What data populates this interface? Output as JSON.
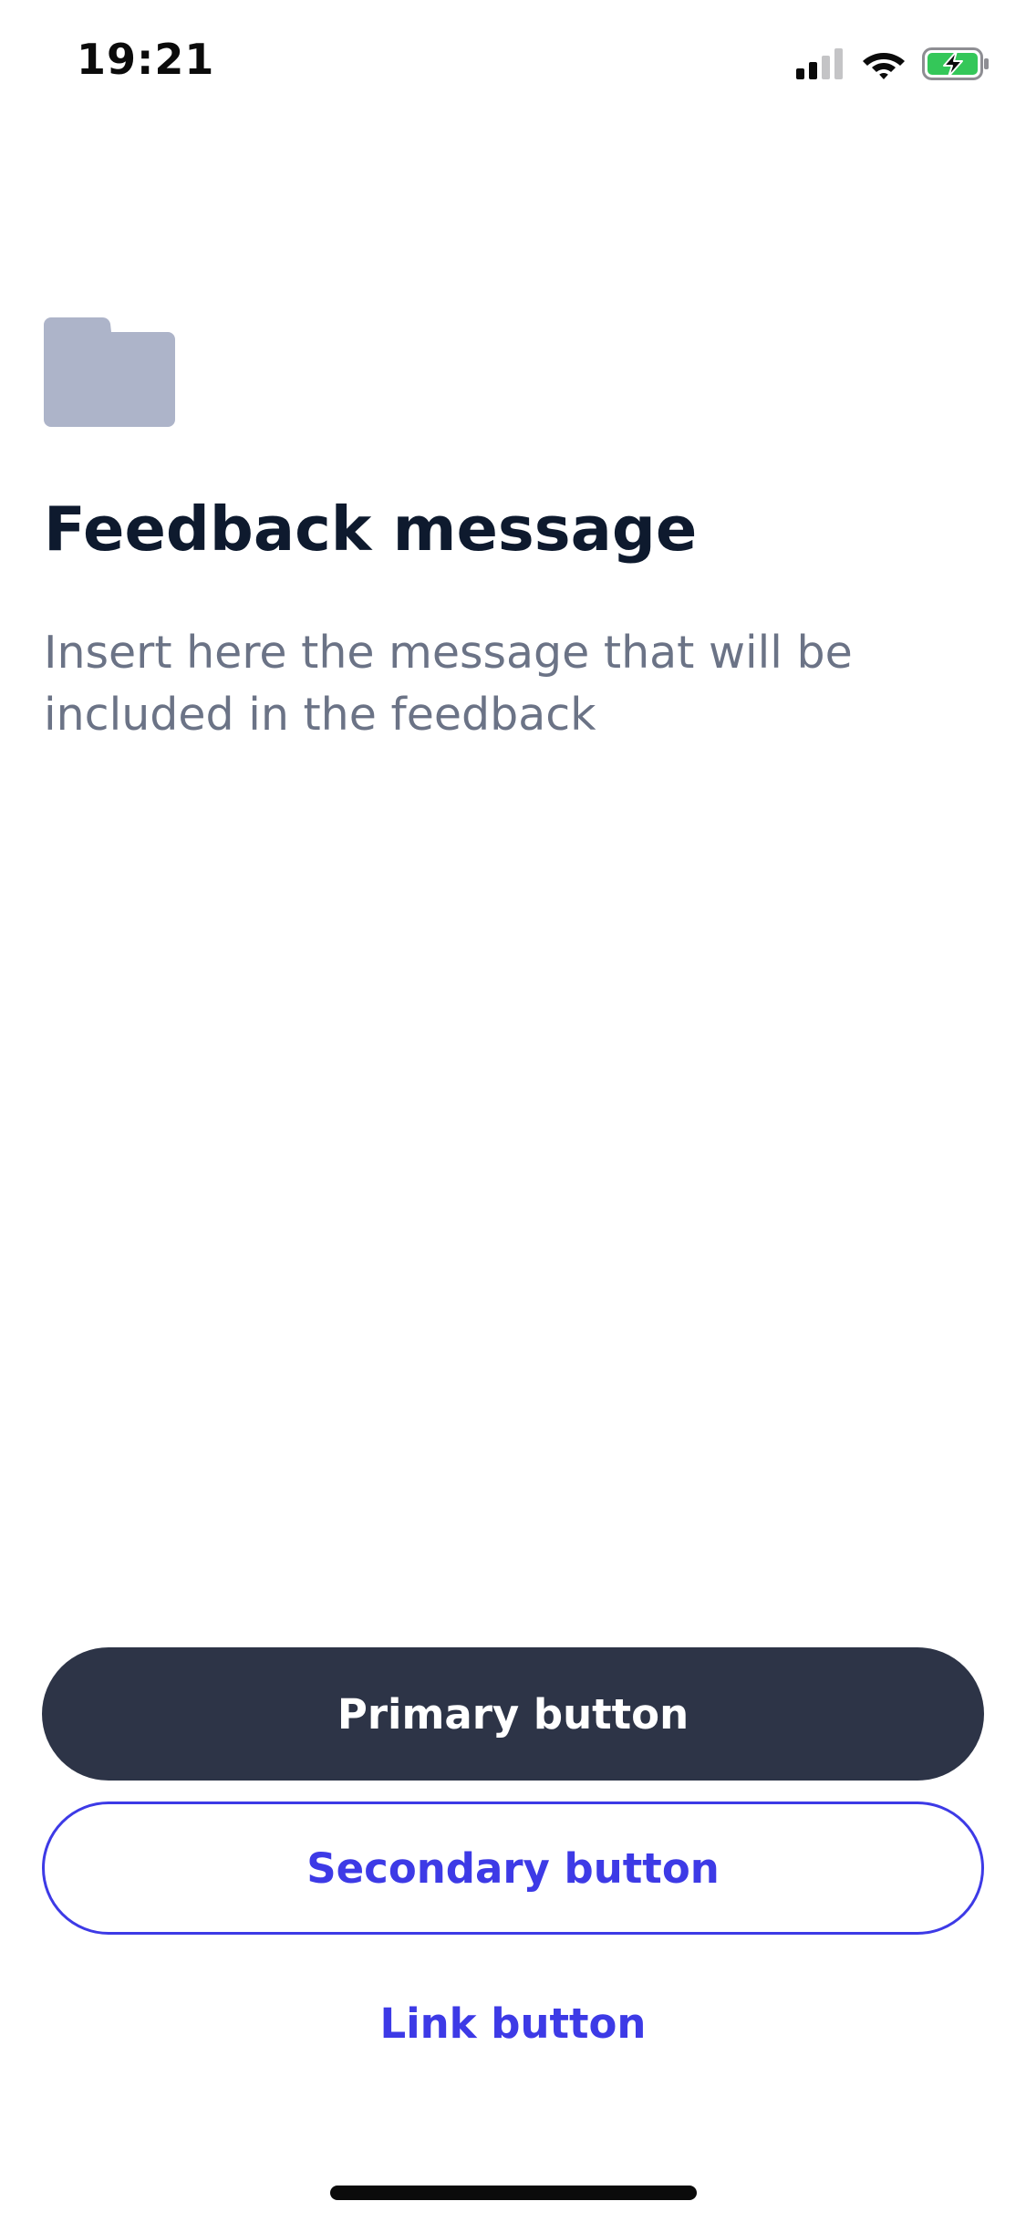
{
  "status_bar": {
    "time": "19:21",
    "icons": [
      "cellular-signal-icon",
      "wifi-icon",
      "battery-charging-icon"
    ],
    "battery_color": "#34c759"
  },
  "feedback": {
    "icon": "folder-icon",
    "icon_color": "#adb4c9",
    "title": "Feedback message",
    "message": "Insert here the message that will be included in the feedback"
  },
  "actions": {
    "primary_label": "Primary button",
    "secondary_label": "Secondary button",
    "link_label": "Link button"
  },
  "colors": {
    "primary_bg": "#2d3447",
    "accent": "#3d3ae6",
    "title_text": "#0e1a2e",
    "body_text": "#6b7386"
  }
}
